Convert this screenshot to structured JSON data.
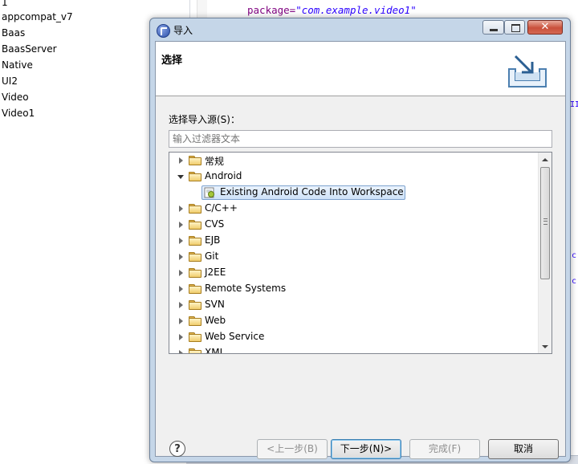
{
  "project_list": [
    "1",
    "appcompat_v7",
    "Baas",
    "BaasServer",
    "Native",
    "UI2",
    "Video",
    "Video1"
  ],
  "editor": {
    "attr": "package=",
    "value": "\"com.example.video1\"",
    "frag_right_1": "II",
    "frag_right_2": "c",
    "frag_right_3": "c"
  },
  "dialog": {
    "title": "导入",
    "window_buttons": {
      "minimize": "minimize-icon",
      "maximize": "maximize-icon",
      "close": "✕"
    },
    "banner_title": "选择",
    "source_label": "选择导入源(S)：",
    "filter_placeholder": "输入过滤器文本",
    "tree": [
      {
        "label": "常规",
        "state": "collapsed",
        "level": 0
      },
      {
        "label": "Android",
        "state": "expanded",
        "level": 0
      },
      {
        "label": "Existing Android Code Into Workspace",
        "state": "selected",
        "level": 1
      },
      {
        "label": "C/C++",
        "state": "collapsed",
        "level": 0
      },
      {
        "label": "CVS",
        "state": "collapsed",
        "level": 0
      },
      {
        "label": "EJB",
        "state": "collapsed",
        "level": 0
      },
      {
        "label": "Git",
        "state": "collapsed",
        "level": 0
      },
      {
        "label": "J2EE",
        "state": "collapsed",
        "level": 0
      },
      {
        "label": "Remote Systems",
        "state": "collapsed",
        "level": 0
      },
      {
        "label": "SVN",
        "state": "collapsed",
        "level": 0
      },
      {
        "label": "Web",
        "state": "collapsed",
        "level": 0
      },
      {
        "label": "Web Service",
        "state": "collapsed",
        "level": 0
      },
      {
        "label": "XML",
        "state": "collapsed",
        "level": 0
      }
    ],
    "help": "?",
    "buttons": {
      "back": "<上一步(B)",
      "next": "下一步(N)>",
      "finish": "完成(F)",
      "cancel": "取消"
    }
  }
}
